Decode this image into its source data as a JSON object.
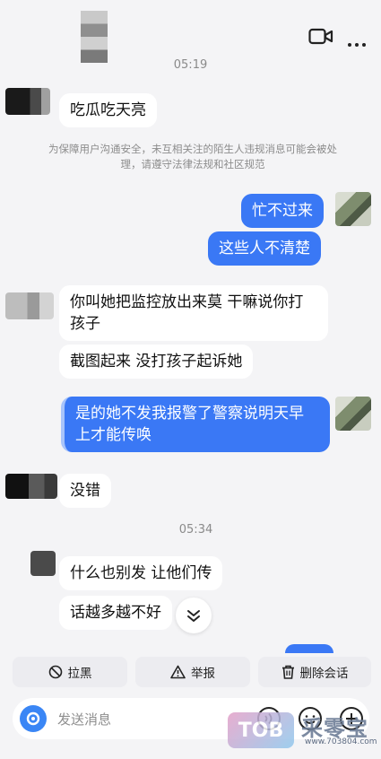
{
  "header": {
    "video_icon": "video-camera-icon",
    "more_icon": "more-dots-icon"
  },
  "times": [
    "05:19",
    "05:34"
  ],
  "notice": "为保障用户沟通安全，未互相关注的陌生人违规消息可能会被处理，请遵守法律法规和社区规范",
  "messages": [
    {
      "side": "in",
      "lines": [
        "吃瓜吃天亮"
      ]
    },
    {
      "side": "out",
      "lines": [
        "忙不过来"
      ]
    },
    {
      "side": "out",
      "lines": [
        "这些人不清楚"
      ]
    },
    {
      "side": "in",
      "lines": [
        "你叫她把监控放出来莫 干嘛说你打",
        "孩子"
      ]
    },
    {
      "side": "in",
      "lines": [
        "截图起来 没打孩子起诉她"
      ]
    },
    {
      "side": "out",
      "lines": [
        "是的她不发我报警了警察说明天早",
        "上才能传唤"
      ]
    },
    {
      "side": "in",
      "lines": [
        "没错"
      ]
    },
    {
      "side": "in",
      "lines": [
        "什么也别发 让他们传"
      ]
    },
    {
      "side": "in",
      "lines": [
        "话越多越不好"
      ]
    }
  ],
  "actions": [
    {
      "label": "拉黑",
      "icon": "block-icon"
    },
    {
      "label": "举报",
      "icon": "warning-icon"
    },
    {
      "label": "删除会话",
      "icon": "trash-icon"
    }
  ],
  "input": {
    "placeholder": "发送消息",
    "icons": [
      "app-logo-icon",
      "voice-icon",
      "emoji-icon",
      "plus-icon"
    ]
  },
  "watermark": {
    "badge": "TOB",
    "name": "采零宝",
    "url": "www.703804.com"
  },
  "colors": {
    "outgoing_bubble": "#3a78f5",
    "incoming_bubble": "#ffffff",
    "background": "#f4f4f6"
  }
}
